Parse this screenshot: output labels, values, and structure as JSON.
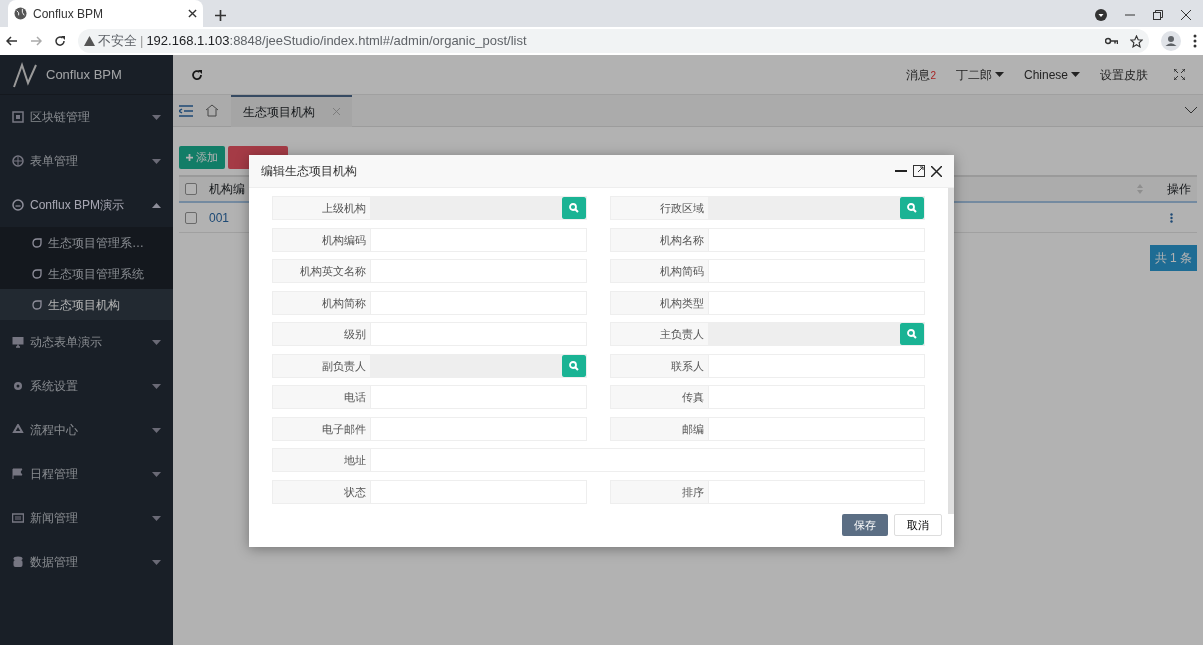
{
  "browser": {
    "tab_title": "Conflux BPM",
    "security": "不安全",
    "separator": "|",
    "url_host": "192.168.1.103",
    "url_rest": ":8848/jeeStudio/index.html#/admin/organic_post/list"
  },
  "sidebar": {
    "brand": "Conflux BPM",
    "items": [
      {
        "label": "区块链管理",
        "expanded": false
      },
      {
        "label": "表单管理",
        "expanded": false
      },
      {
        "label": "Conflux BPM演示",
        "expanded": true,
        "children": [
          {
            "label": "生态项目管理系…",
            "selected": false
          },
          {
            "label": "生态项目管理系统",
            "selected": false
          },
          {
            "label": "生态项目机构",
            "selected": true
          }
        ]
      },
      {
        "label": "动态表单演示",
        "expanded": false
      },
      {
        "label": "系统设置",
        "expanded": false
      },
      {
        "label": "流程中心",
        "expanded": false
      },
      {
        "label": "日程管理",
        "expanded": false
      },
      {
        "label": "新闻管理",
        "expanded": false
      },
      {
        "label": "数据管理",
        "expanded": false
      }
    ]
  },
  "header": {
    "messages": "消息",
    "message_count": "2",
    "user": "丁二郎",
    "language": "Chinese",
    "skin": "设置皮肤"
  },
  "tabs": [
    {
      "label": "生态项目机构",
      "selected": true
    }
  ],
  "toolbar": {
    "add": "添加"
  },
  "table": {
    "columns": [
      "机构编",
      "操作"
    ],
    "all_checked": false,
    "rows": [
      {
        "checked": false,
        "cells": [
          "001"
        ]
      }
    ],
    "pagination": "共 1 条"
  },
  "modal": {
    "title": "编辑生态项目机构",
    "fields": [
      {
        "label": "上级机构",
        "kind": "lookup"
      },
      {
        "label": "行政区域",
        "kind": "lookup"
      },
      {
        "label": "机构编码",
        "kind": "text"
      },
      {
        "label": "机构名称",
        "kind": "text"
      },
      {
        "label": "机构英文名称",
        "kind": "text"
      },
      {
        "label": "机构简码",
        "kind": "text"
      },
      {
        "label": "机构简称",
        "kind": "text"
      },
      {
        "label": "机构类型",
        "kind": "text"
      },
      {
        "label": "级别",
        "kind": "text"
      },
      {
        "label": "主负责人",
        "kind": "lookup"
      },
      {
        "label": "副负责人",
        "kind": "lookup"
      },
      {
        "label": "联系人",
        "kind": "text"
      },
      {
        "label": "电话",
        "kind": "text"
      },
      {
        "label": "传真",
        "kind": "text"
      },
      {
        "label": "电子邮件",
        "kind": "text"
      },
      {
        "label": "邮编",
        "kind": "text"
      },
      {
        "label": "地址",
        "kind": "wide"
      },
      {
        "label": "状态",
        "kind": "text"
      },
      {
        "label": "排序",
        "kind": "text"
      }
    ],
    "save": "保存",
    "cancel": "取消"
  }
}
